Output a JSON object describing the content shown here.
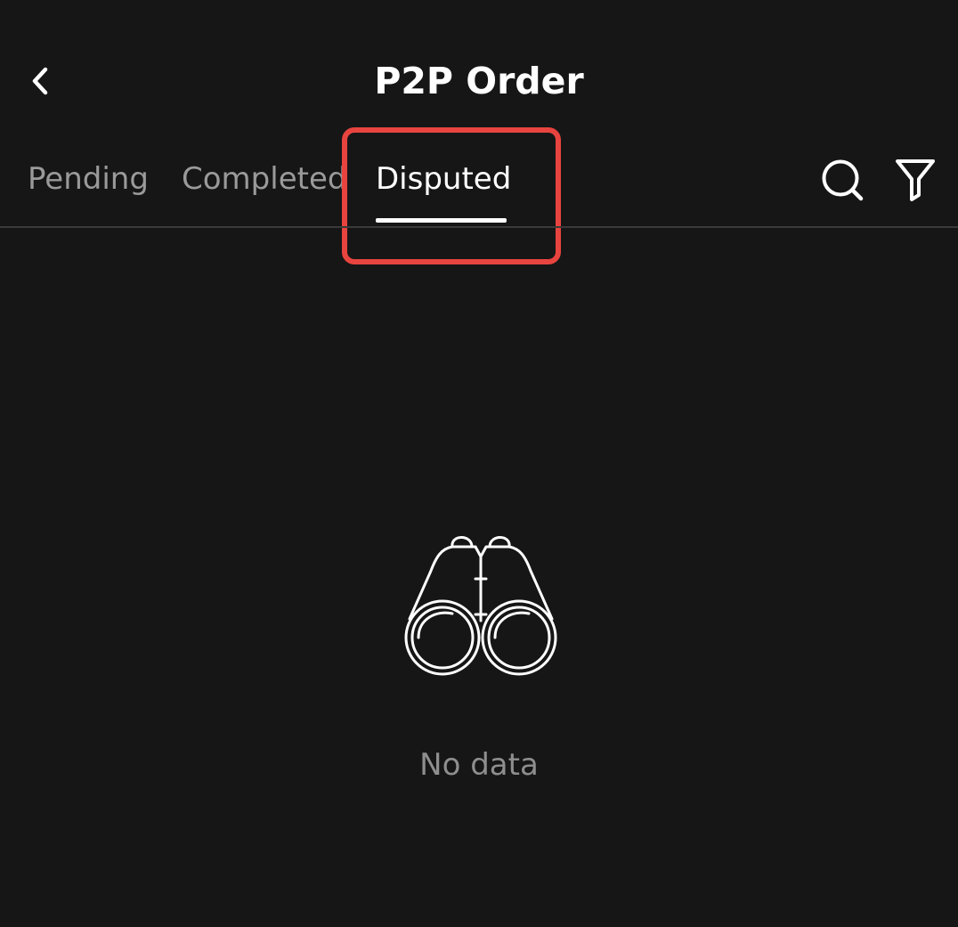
{
  "header": {
    "title": "P2P Order",
    "back_icon": "chevron-left-icon"
  },
  "tabs": [
    {
      "label": "Pending",
      "active": false
    },
    {
      "label": "Completed",
      "active": false
    },
    {
      "label": "Disputed",
      "active": true
    }
  ],
  "toolbar": {
    "search_icon": "search-icon",
    "filter_icon": "filter-icon"
  },
  "empty_state": {
    "icon": "binoculars-icon",
    "message": "No data"
  },
  "colors": {
    "background": "#161616",
    "highlight": "#e8443f",
    "inactive_tab": "#9a9a9a",
    "active_tab": "#ffffff"
  }
}
